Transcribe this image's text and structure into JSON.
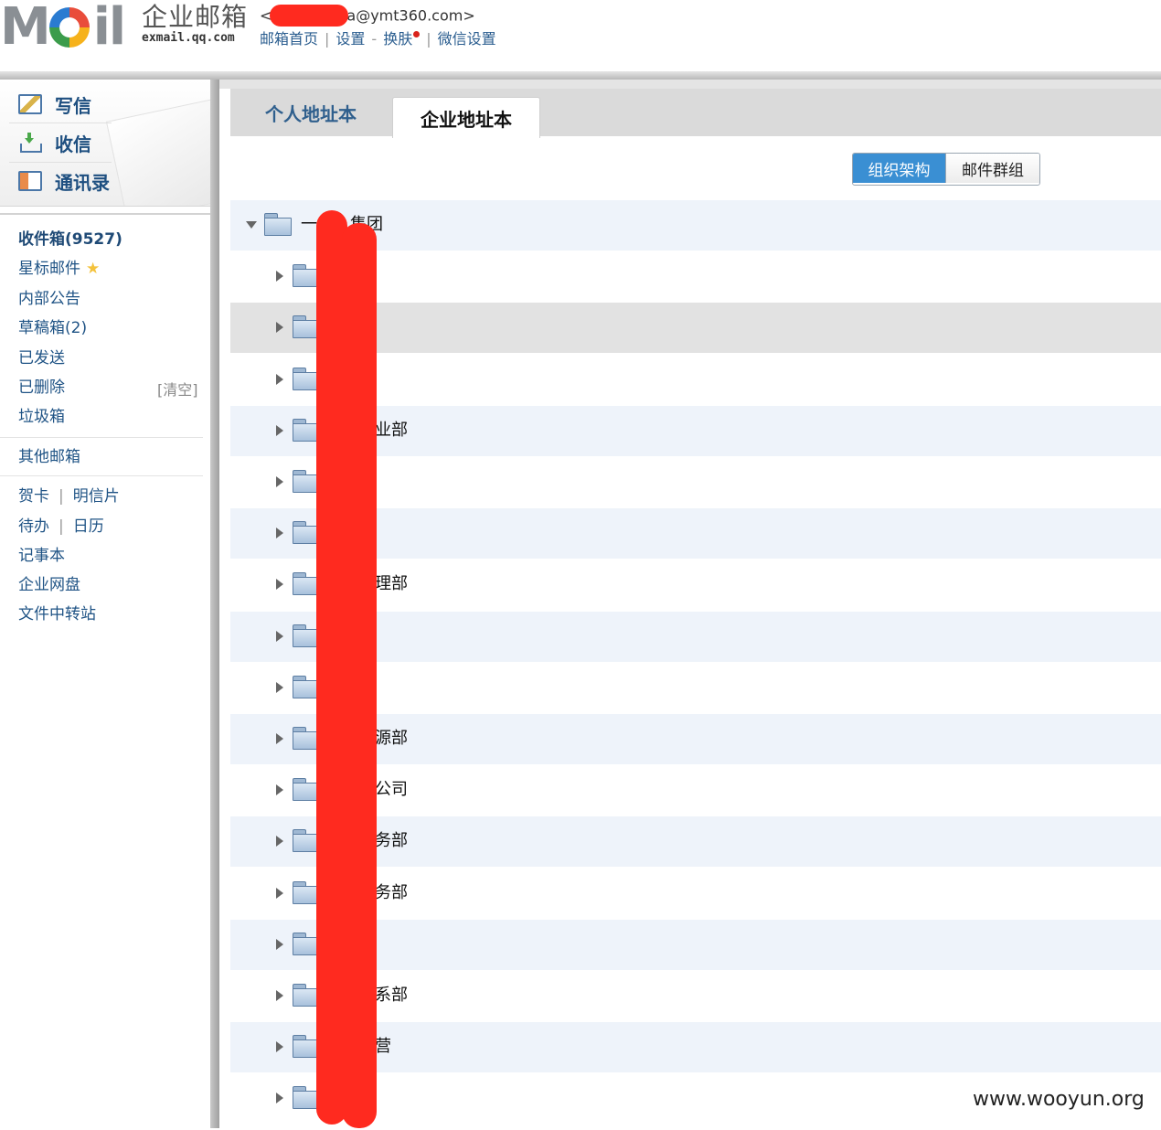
{
  "header": {
    "logo_text": "MOil",
    "brand_cn": "企业邮箱",
    "brand_en": "exmail.qq.com",
    "account_prefix": "<",
    "account_suffix": "a@ymt360.com>",
    "links": [
      "邮箱首页",
      "设置",
      "换肤",
      "微信设置"
    ],
    "separators": [
      "|",
      "-",
      "|"
    ]
  },
  "sidebar": {
    "quick": [
      {
        "label": "写信",
        "icon": "compose-icon"
      },
      {
        "label": "收信",
        "icon": "receive-icon"
      },
      {
        "label": "通讯录",
        "icon": "contacts-icon"
      }
    ],
    "folders": {
      "inbox": "收件箱(9527)",
      "starred": "星标邮件",
      "starred_icon": "★",
      "notice": "内部公告",
      "drafts": "草稿箱(2)",
      "sent": "已发送",
      "deleted": "已删除",
      "deleted_action": "[清空]",
      "spam": "垃圾箱"
    },
    "other": "其他邮箱",
    "tools": {
      "greeting_card": "贺卡",
      "postcard": "明信片",
      "todo": "待办",
      "calendar": "日历",
      "notebook": "记事本",
      "disk": "企业网盘",
      "transfer": "文件中转站",
      "pipe": "|"
    }
  },
  "main": {
    "tabs": {
      "personal": "个人地址本",
      "company": "企业地址本"
    },
    "toggle": {
      "org": "组织架构",
      "groups": "邮件群组"
    },
    "root": {
      "label_visible": "一",
      "label_tail": "集团"
    },
    "rows": [
      "",
      "",
      "",
      "业部",
      "",
      "",
      "理部",
      "",
      "",
      "源部",
      "公司",
      "务部",
      "务部",
      "",
      "系部",
      "营",
      ""
    ]
  },
  "colors": {
    "accent": "#3a8fd3",
    "link": "#1f5385",
    "row_alt": "#eef3fa",
    "redaction": "#ff2a1f"
  },
  "watermark": "www.wooyun.org"
}
